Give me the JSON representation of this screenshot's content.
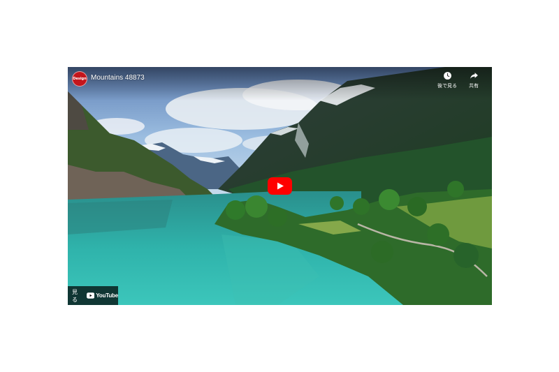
{
  "video": {
    "title": "Mountains 48873",
    "channel_avatar_text": "Design"
  },
  "actions": {
    "watch_later_label": "後で見る",
    "share_label": "共有"
  },
  "bottom_bar": {
    "watch_label": "見る",
    "brand_label": "YouTube"
  },
  "colors": {
    "play_button": "#ff0000",
    "avatar_bg": "#c4161c"
  },
  "icons": [
    "clock-icon",
    "share-arrow-icon",
    "play-icon",
    "youtube-logo-icon"
  ]
}
